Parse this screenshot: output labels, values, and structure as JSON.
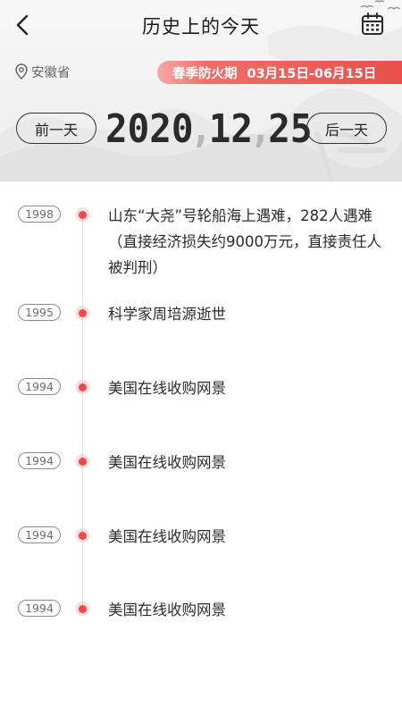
{
  "header": {
    "title": "历史上的今天",
    "location": "安徽省",
    "season_label": "春季防火期",
    "season_range": "03月15日-06月15日",
    "prev_label": "前一天",
    "next_label": "后一天",
    "date": {
      "year": "2020",
      "month": "12",
      "day": "25",
      "separator": ","
    },
    "icons": {
      "back": "chevron-left-icon",
      "calendar": "calendar-icon",
      "location": "location-pin-icon"
    }
  },
  "colors": {
    "accent": "#ee4a4a",
    "badge_gradient_start": "#f7a9a6",
    "badge_gradient_end": "#ea4f4b",
    "text": "#2b2b2b",
    "muted": "#666666"
  },
  "events": [
    {
      "year": "1998",
      "text": "山东“大尧”号轮船海上遇难，282人遇难（直接经济损失约9000万元，直接责任人被判刑）"
    },
    {
      "year": "1995",
      "text": "科学家周培源逝世"
    },
    {
      "year": "1994",
      "text": "美国在线收购网景"
    },
    {
      "year": "1994",
      "text": "美国在线收购网景"
    },
    {
      "year": "1994",
      "text": "美国在线收购网景"
    },
    {
      "year": "1994",
      "text": "美国在线收购网景"
    }
  ]
}
